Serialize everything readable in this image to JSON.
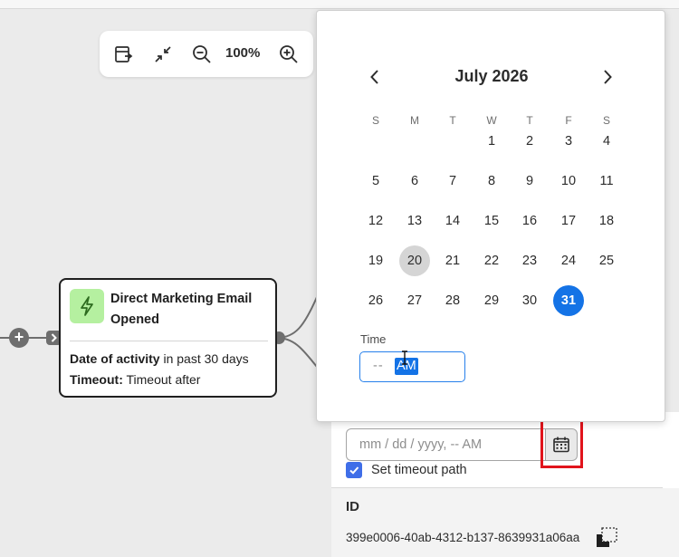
{
  "toolbar": {
    "zoom_level": "100%",
    "icons": [
      "fit-canvas-icon",
      "collapse-icon",
      "zoom-out-icon",
      "zoom-in-icon"
    ]
  },
  "node": {
    "title": "Direct Marketing Email Opened",
    "condition_label": "Date of activity",
    "condition_value": " in past 30 days",
    "timeout_label": "Timeout:",
    "timeout_value": " Timeout after",
    "icon": "lightning-icon",
    "icon_bg_color": "#b5f0a0"
  },
  "calendar": {
    "month_title": "July 2026",
    "weekdays": [
      "S",
      "M",
      "T",
      "W",
      "T",
      "F",
      "S"
    ],
    "weeks": [
      [
        "",
        "",
        "",
        "1",
        "2",
        "3",
        "4"
      ],
      [
        "5",
        "6",
        "7",
        "8",
        "9",
        "10",
        "11"
      ],
      [
        "12",
        "13",
        "14",
        "15",
        "16",
        "17",
        "18"
      ],
      [
        "19",
        "20",
        "21",
        "22",
        "23",
        "24",
        "25"
      ],
      [
        "26",
        "27",
        "28",
        "29",
        "30",
        "31",
        ""
      ]
    ],
    "today": "20",
    "selected": "31",
    "selected_color": "#1473e6",
    "time_label": "Time",
    "time_placeholder": "-- ",
    "ampm": "AM"
  },
  "panel": {
    "date_placeholder": "mm / dd / yyyy,  --  AM",
    "timeout_checkbox_label": "Set timeout path",
    "timeout_checked": true,
    "id_heading": "ID",
    "id_value": "399e0006-40ab-4312-b137-8639931a06aa",
    "highlight_color": "#e1141c"
  }
}
